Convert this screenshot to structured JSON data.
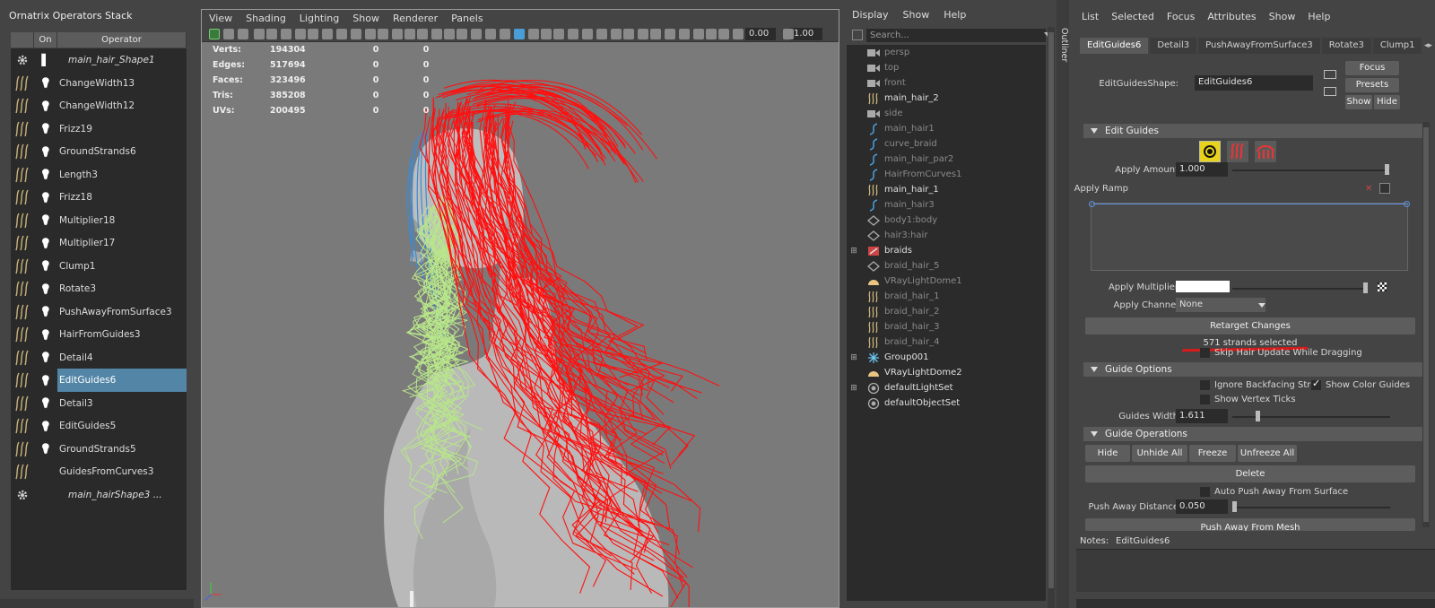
{
  "ornatrix": {
    "title": "Ornatrix Operators Stack",
    "col_on": "On",
    "col_operator": "Operator",
    "operators": [
      {
        "name": "main_hair_Shape1",
        "icon": "gear-icon",
        "bulb": false,
        "italic": true
      },
      {
        "name": "ChangeWidth13",
        "icon": "change-width-icon",
        "bulb": true
      },
      {
        "name": "ChangeWidth12",
        "icon": "change-width-icon",
        "bulb": true
      },
      {
        "name": "Frizz19",
        "icon": "frizz-icon",
        "bulb": true
      },
      {
        "name": "GroundStrands6",
        "icon": "ground-strands-icon",
        "bulb": true
      },
      {
        "name": "Length3",
        "icon": "length-icon",
        "bulb": true
      },
      {
        "name": "Frizz18",
        "icon": "frizz-icon",
        "bulb": true
      },
      {
        "name": "Multiplier18",
        "icon": "multiplier-icon",
        "bulb": true
      },
      {
        "name": "Multiplier17",
        "icon": "multiplier-icon",
        "bulb": true
      },
      {
        "name": "Clump1",
        "icon": "clump-icon",
        "bulb": true
      },
      {
        "name": "Rotate3",
        "icon": "rotate-icon",
        "bulb": true
      },
      {
        "name": "PushAwayFromSurface3",
        "icon": "push-away-icon",
        "bulb": true
      },
      {
        "name": "HairFromGuides3",
        "icon": "hair-from-guides-icon",
        "bulb": true
      },
      {
        "name": "Detail4",
        "icon": "detail-icon",
        "bulb": true
      },
      {
        "name": "EditGuides6",
        "icon": "edit-guides-icon",
        "bulb": true,
        "selected": true
      },
      {
        "name": "Detail3",
        "icon": "detail-icon",
        "bulb": true
      },
      {
        "name": "EditGuides5",
        "icon": "edit-guides-icon",
        "bulb": true
      },
      {
        "name": "GroundStrands5",
        "icon": "ground-strands-icon",
        "bulb": true
      },
      {
        "name": "GuidesFromCurves3",
        "icon": "guides-from-curves-icon",
        "bulb": false
      },
      {
        "name": "main_hairShape3 ...",
        "icon": "gear-icon",
        "bulb": false,
        "italic": true
      }
    ]
  },
  "viewport": {
    "menu": [
      "View",
      "Shading",
      "Lighting",
      "Show",
      "Renderer",
      "Panels"
    ],
    "field1": "0.00",
    "field2": "1.00",
    "hud": [
      {
        "label": "Verts:",
        "v1": "194304",
        "v2": "0",
        "v3": "0"
      },
      {
        "label": "Edges:",
        "v1": "517694",
        "v2": "0",
        "v3": "0"
      },
      {
        "label": "Faces:",
        "v1": "323496",
        "v2": "0",
        "v3": "0"
      },
      {
        "label": "Tris:",
        "v1": "385208",
        "v2": "0",
        "v3": "0"
      },
      {
        "label": "UVs:",
        "v1": "200495",
        "v2": "0",
        "v3": "0"
      }
    ],
    "colors": {
      "hair_red": "#ff1010",
      "hair_green": "#b8e68a",
      "hair_blue": "#3a8bd8",
      "model": "#b8b8b8",
      "bg": "#7a7a7a"
    }
  },
  "outliner": {
    "menu": [
      "Display",
      "Show",
      "Help"
    ],
    "search_placeholder": "Search...",
    "tab_label": "Outliner",
    "items": [
      {
        "label": "persp",
        "icon": "camera-icon",
        "dim": true
      },
      {
        "label": "top",
        "icon": "camera-icon",
        "dim": true
      },
      {
        "label": "front",
        "icon": "camera-icon",
        "dim": true
      },
      {
        "label": "main_hair_2",
        "icon": "hair-icon",
        "dim": false
      },
      {
        "label": "side",
        "icon": "camera-icon",
        "dim": true
      },
      {
        "label": "main_hair1",
        "icon": "curve-icon",
        "dim": true
      },
      {
        "label": "curve_braid",
        "icon": "curve-icon",
        "dim": true
      },
      {
        "label": "main_hair_par2",
        "icon": "curve-icon",
        "dim": true
      },
      {
        "label": "HairFromCurves1",
        "icon": "curve-icon",
        "dim": true
      },
      {
        "label": "main_hair_1",
        "icon": "hair-icon",
        "dim": false
      },
      {
        "label": "main_hair3",
        "icon": "curve-icon",
        "dim": true
      },
      {
        "label": "body1:body",
        "icon": "mesh-icon",
        "dim": true
      },
      {
        "label": "hair3:hair",
        "icon": "mesh-icon",
        "dim": true
      },
      {
        "label": "braids",
        "icon": "group-icon",
        "dim": false,
        "expand": true
      },
      {
        "label": "braid_hair_5",
        "icon": "mesh-icon",
        "dim": true
      },
      {
        "label": "VRayLightDome1",
        "icon": "dome-icon",
        "dim": true
      },
      {
        "label": "braid_hair_1",
        "icon": "hair-icon",
        "dim": true
      },
      {
        "label": "braid_hair_2",
        "icon": "hair-icon",
        "dim": true
      },
      {
        "label": "braid_hair_3",
        "icon": "hair-icon",
        "dim": true
      },
      {
        "label": "braid_hair_4",
        "icon": "hair-icon",
        "dim": true
      },
      {
        "label": "Group001",
        "icon": "star-icon",
        "dim": false,
        "expand": true
      },
      {
        "label": "VRayLightDome2",
        "icon": "dome-icon",
        "dim": false
      },
      {
        "label": "defaultLightSet",
        "icon": "set-icon",
        "dim": false,
        "expand": true
      },
      {
        "label": "defaultObjectSet",
        "icon": "set-icon",
        "dim": false
      }
    ]
  },
  "attr": {
    "menu": [
      "List",
      "Selected",
      "Focus",
      "Attributes",
      "Show",
      "Help"
    ],
    "tabs": [
      "EditGuides6",
      "Detail3",
      "PushAwayFromSurface3",
      "Rotate3",
      "Clump1"
    ],
    "shape_label": "EditGuidesShape:",
    "shape_value": "EditGuides6",
    "focus": "Focus",
    "presets": "Presets",
    "show": "Show",
    "hide": "Hide",
    "sec_edit": "Edit Guides",
    "apply_amount_label": "Apply Amount",
    "apply_amount": "1.000",
    "apply_ramp_label": "Apply Ramp",
    "apply_multiplier_label": "Apply Multiplier",
    "apply_channel_label": "Apply Channel",
    "apply_channel": "None",
    "retarget": "Retarget Changes",
    "strands": "571 strands selected",
    "skip": "Skip Hair Update While Dragging",
    "sec_options": "Guide Options",
    "ignore": "Ignore Backfacing Strar",
    "show_color": "Show Color Guides",
    "show_ticks": "Show Vertex Ticks",
    "width_label": "Guides Width",
    "width": "1.611",
    "sec_ops": "Guide Operations",
    "hide_btn": "Hide",
    "unhide": "Unhide All",
    "freeze": "Freeze",
    "unfreeze": "Unfreeze All",
    "delete": "Delete",
    "auto_push": "Auto Push Away From Surface",
    "push_label": "Push Away Distance",
    "push": "0.050",
    "push_mesh": "Push Away From Mesh",
    "notes_label": "Notes:",
    "notes_value": "EditGuides6",
    "accent": "#d91a1a"
  }
}
